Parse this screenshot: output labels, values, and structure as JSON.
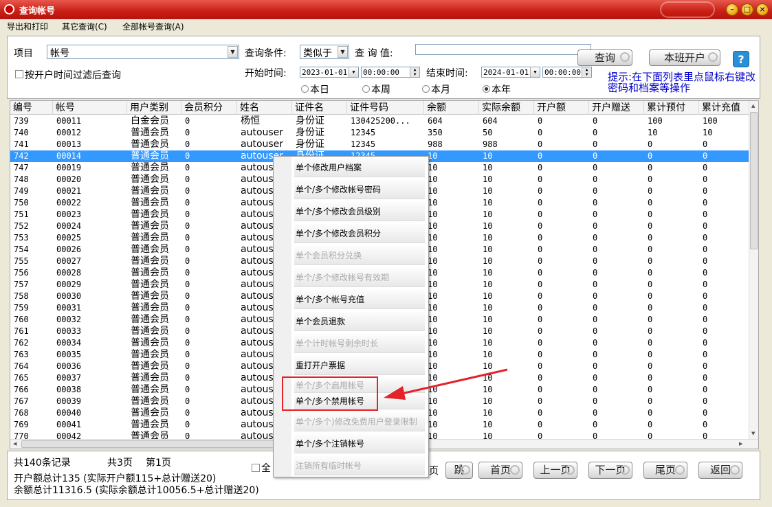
{
  "window": {
    "title": "查询帐号"
  },
  "menubar": [
    "导出和打印",
    "其它查询(C)",
    "全部帐号查询(A)"
  ],
  "filters": {
    "item_label": "项目",
    "item_value": "帐号",
    "condition_label": "查询条件:",
    "condition_value": "类似于",
    "query_value_label": "查 询 值:",
    "query_value": "",
    "filter_by_time_label": "按开户时间过滤后查询",
    "start_time_label": "开始时间:",
    "start_date": "2023-01-01",
    "start_time": "00:00:00",
    "end_time_label": "结束时间:",
    "end_date": "2024-01-01",
    "end_time": "00:00:00",
    "ranges": [
      "本日",
      "本周",
      "本月",
      "本年"
    ],
    "selected_range": "本年",
    "query_button": "查询",
    "open_account_button": "本班开户",
    "hint": "提示:在下面列表里点鼠标右键改密码和档案等操作"
  },
  "table": {
    "columns": [
      "编号",
      "帐号",
      "用户类别",
      "会员积分",
      "姓名",
      "证件名",
      "证件号码",
      "余额",
      "实际余额",
      "开户额",
      "开户赠送",
      "累计预付",
      "累计充值"
    ],
    "rows": [
      [
        "739",
        "00011",
        "白金会员",
        "0",
        "杨恒",
        "身份证",
        "130425200...",
        "604",
        "604",
        "0",
        "0",
        "100",
        "100"
      ],
      [
        "740",
        "00012",
        "普通会员",
        "0",
        "autouser",
        "身份证",
        "12345",
        "350",
        "50",
        "0",
        "0",
        "10",
        "10"
      ],
      [
        "741",
        "00013",
        "普通会员",
        "0",
        "autouser",
        "身份证",
        "12345",
        "988",
        "988",
        "0",
        "0",
        "0",
        "0"
      ],
      [
        "742",
        "00014",
        "普通会员",
        "0",
        "autouser",
        "身份证",
        "12345",
        "10",
        "10",
        "0",
        "0",
        "0",
        "0"
      ],
      [
        "747",
        "00019",
        "普通会员",
        "0",
        "autous",
        "",
        "",
        "10",
        "10",
        "0",
        "0",
        "0",
        "0"
      ],
      [
        "748",
        "00020",
        "普通会员",
        "0",
        "autous",
        "",
        "",
        "10",
        "10",
        "0",
        "0",
        "0",
        "0"
      ],
      [
        "749",
        "00021",
        "普通会员",
        "0",
        "autous",
        "",
        "",
        "10",
        "10",
        "0",
        "0",
        "0",
        "0"
      ],
      [
        "750",
        "00022",
        "普通会员",
        "0",
        "autous",
        "",
        "",
        "10",
        "10",
        "0",
        "0",
        "0",
        "0"
      ],
      [
        "751",
        "00023",
        "普通会员",
        "0",
        "autous",
        "",
        "",
        "10",
        "10",
        "0",
        "0",
        "0",
        "0"
      ],
      [
        "752",
        "00024",
        "普通会员",
        "0",
        "autous",
        "",
        "",
        "10",
        "10",
        "0",
        "0",
        "0",
        "0"
      ],
      [
        "753",
        "00025",
        "普通会员",
        "0",
        "autous",
        "",
        "",
        "10",
        "10",
        "0",
        "0",
        "0",
        "0"
      ],
      [
        "754",
        "00026",
        "普通会员",
        "0",
        "autous",
        "",
        "",
        "10",
        "10",
        "0",
        "0",
        "0",
        "0"
      ],
      [
        "755",
        "00027",
        "普通会员",
        "0",
        "autous",
        "",
        "",
        "10",
        "10",
        "0",
        "0",
        "0",
        "0"
      ],
      [
        "756",
        "00028",
        "普通会员",
        "0",
        "autous",
        "",
        "",
        "10",
        "10",
        "0",
        "0",
        "0",
        "0"
      ],
      [
        "757",
        "00029",
        "普通会员",
        "0",
        "autous",
        "",
        "",
        "10",
        "10",
        "0",
        "0",
        "0",
        "0"
      ],
      [
        "758",
        "00030",
        "普通会员",
        "0",
        "autous",
        "",
        "",
        "10",
        "10",
        "0",
        "0",
        "0",
        "0"
      ],
      [
        "759",
        "00031",
        "普通会员",
        "0",
        "autous",
        "",
        "",
        "10",
        "10",
        "0",
        "0",
        "0",
        "0"
      ],
      [
        "760",
        "00032",
        "普通会员",
        "0",
        "autous",
        "",
        "",
        "10",
        "10",
        "0",
        "0",
        "0",
        "0"
      ],
      [
        "761",
        "00033",
        "普通会员",
        "0",
        "autous",
        "",
        "",
        "10",
        "10",
        "0",
        "0",
        "0",
        "0"
      ],
      [
        "762",
        "00034",
        "普通会员",
        "0",
        "autous",
        "",
        "",
        "10",
        "10",
        "0",
        "0",
        "0",
        "0"
      ],
      [
        "763",
        "00035",
        "普通会员",
        "0",
        "autous",
        "",
        "",
        "10",
        "10",
        "0",
        "0",
        "0",
        "0"
      ],
      [
        "764",
        "00036",
        "普通会员",
        "0",
        "autous",
        "",
        "",
        "10",
        "10",
        "0",
        "0",
        "0",
        "0"
      ],
      [
        "765",
        "00037",
        "普通会员",
        "0",
        "autous",
        "",
        "",
        "10",
        "10",
        "0",
        "0",
        "0",
        "0"
      ],
      [
        "766",
        "00038",
        "普通会员",
        "0",
        "autous",
        "",
        "",
        "10",
        "10",
        "0",
        "0",
        "0",
        "0"
      ],
      [
        "767",
        "00039",
        "普通会员",
        "0",
        "autous",
        "",
        "",
        "10",
        "10",
        "0",
        "0",
        "0",
        "0"
      ],
      [
        "768",
        "00040",
        "普通会员",
        "0",
        "autous",
        "",
        "",
        "10",
        "10",
        "0",
        "0",
        "0",
        "0"
      ],
      [
        "769",
        "00041",
        "普通会员",
        "0",
        "autous",
        "",
        "",
        "10",
        "10",
        "0",
        "0",
        "0",
        "0"
      ],
      [
        "770",
        "00042",
        "普通会员",
        "0",
        "autous",
        "",
        "",
        "10",
        "10",
        "0",
        "0",
        "0",
        "0"
      ]
    ],
    "selected_row_index": 3
  },
  "context_menu": [
    {
      "label": "单个修改用户档案",
      "enabled": true
    },
    {
      "label": "单个/多个修改帐号密码",
      "enabled": true
    },
    {
      "label": "单个/多个修改会员级别",
      "enabled": true
    },
    {
      "label": "单个/多个修改会员积分",
      "enabled": true
    },
    {
      "label": "单个会员积分兑换",
      "enabled": false
    },
    {
      "label": "单个/多个修改帐号有效期",
      "enabled": false
    },
    {
      "label": "单个/多个帐号充值",
      "enabled": true
    },
    {
      "label": "单个会员退款",
      "enabled": true
    },
    {
      "label": "单个计时帐号剩余时长",
      "enabled": false
    },
    {
      "label": "重打开户票据",
      "enabled": true
    },
    {
      "label": "单个/多个启用帐号",
      "enabled": false
    },
    {
      "label": "单个/多个禁用帐号",
      "enabled": true
    },
    {
      "label": "单个/多个)修改免费用户登录限制",
      "enabled": false
    },
    {
      "label": "单个/多个注销帐号",
      "enabled": true
    },
    {
      "label": "注销所有临时帐号",
      "enabled": false
    }
  ],
  "footer": {
    "records": "共140条记录",
    "pages": "共3页",
    "current_page": "第1页",
    "select_all_fragment": "全",
    "open_total": "开户额总计135 (实际开户额115+总计赠送20)",
    "balance_total": "余额总计11316.5 (实际余额总计10056.5+总计赠送20)",
    "page_fragment": "页",
    "buttons": [
      "跳",
      "首页",
      "上一页",
      "下一页",
      "尾页",
      "返回"
    ]
  },
  "colors": {
    "selection": "#3399ff",
    "highlight": "#e4222a",
    "hint": "#0000cc"
  }
}
